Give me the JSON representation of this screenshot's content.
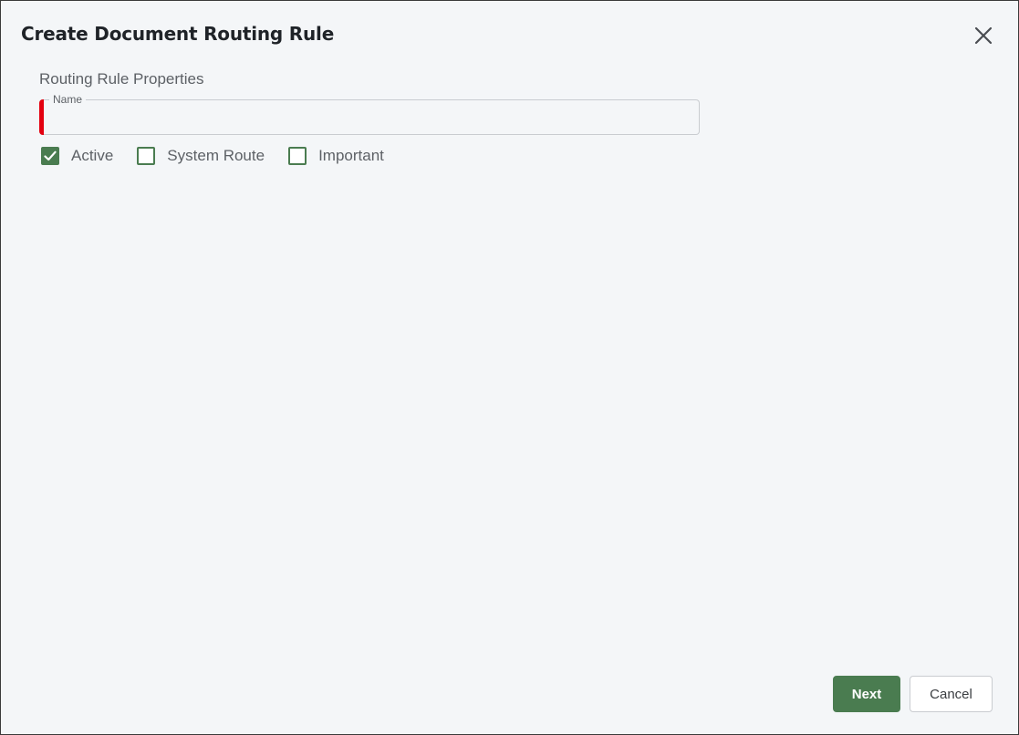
{
  "dialog": {
    "title": "Create Document Routing Rule",
    "close_icon": "close-icon"
  },
  "section": {
    "title": "Routing Rule Properties"
  },
  "name_field": {
    "label": "Name",
    "value": "",
    "placeholder": "",
    "required": true
  },
  "checkboxes": [
    {
      "label": "Active",
      "checked": true
    },
    {
      "label": "System Route",
      "checked": false
    },
    {
      "label": "Important",
      "checked": false
    }
  ],
  "actions": {
    "next_label": "Next",
    "cancel_label": "Cancel"
  },
  "colors": {
    "accent": "#4a7c50",
    "required": "#e3000f",
    "background": "#f4f6f8"
  }
}
